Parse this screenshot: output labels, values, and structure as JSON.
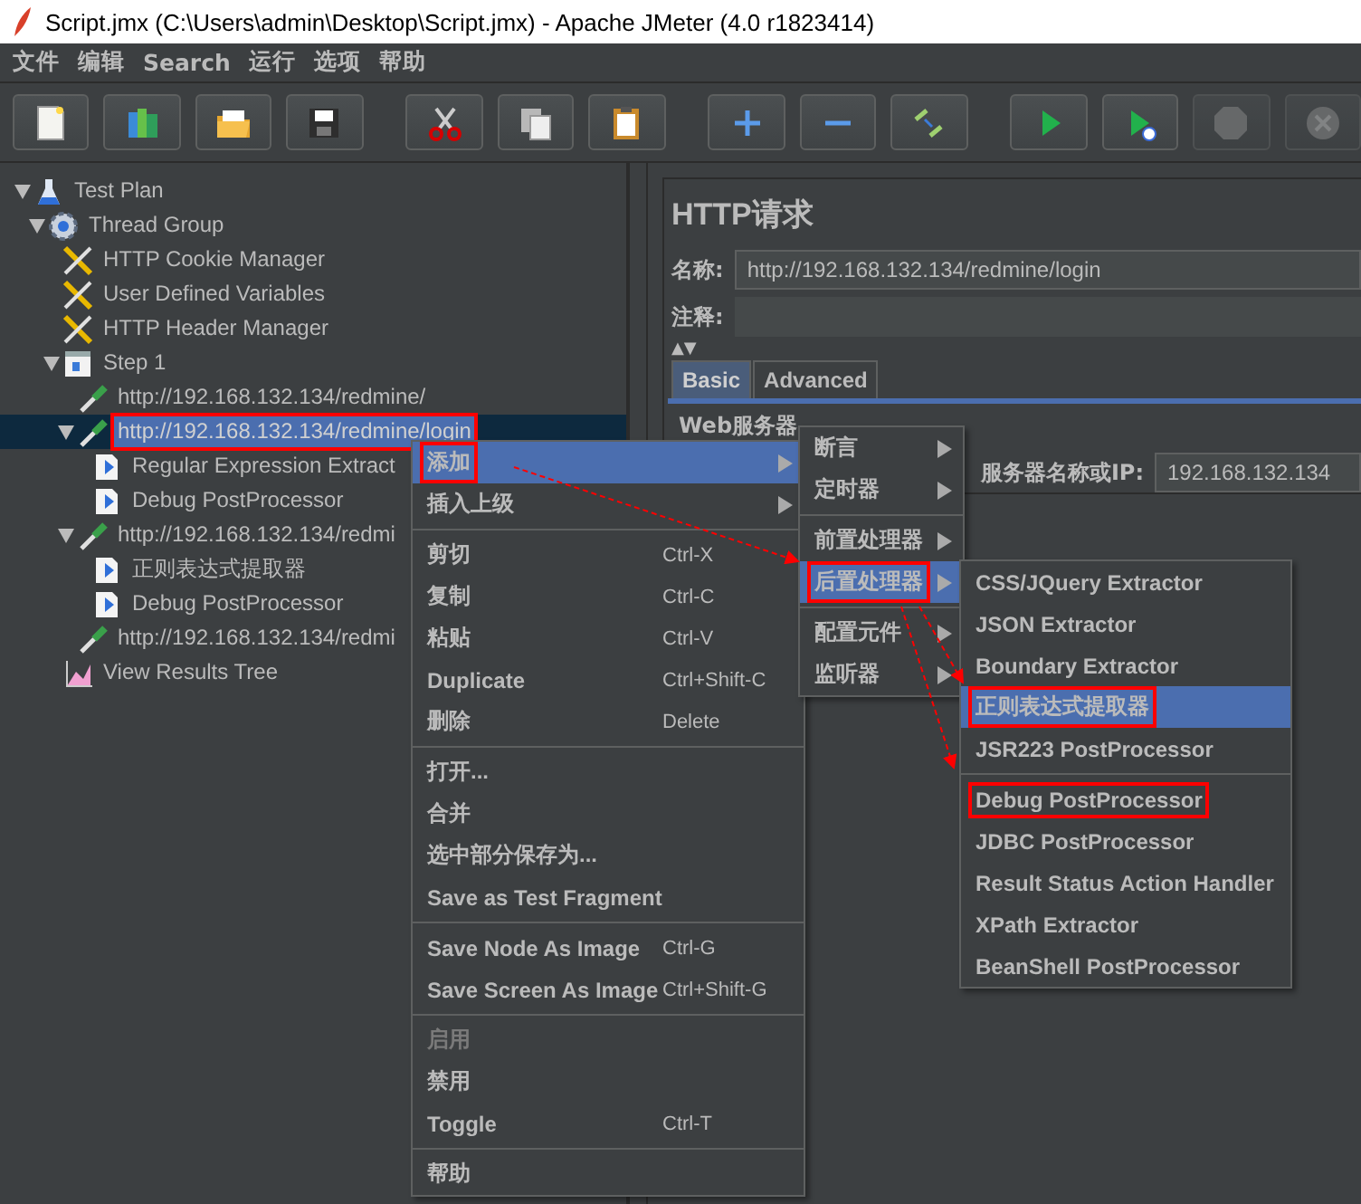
{
  "window": {
    "title": "Script.jmx (C:\\Users\\admin\\Desktop\\Script.jmx) - Apache JMeter (4.0 r1823414)"
  },
  "menubar": [
    "文件",
    "编辑",
    "Search",
    "运行",
    "选项",
    "帮助"
  ],
  "toolbar": [
    {
      "kind": "new",
      "disabled": false
    },
    {
      "kind": "templates",
      "disabled": false
    },
    {
      "kind": "open",
      "disabled": false
    },
    {
      "kind": "save",
      "disabled": false
    },
    {
      "kind": "gap"
    },
    {
      "kind": "cut",
      "disabled": false
    },
    {
      "kind": "copy",
      "disabled": false
    },
    {
      "kind": "paste",
      "disabled": false
    },
    {
      "kind": "gap"
    },
    {
      "kind": "expand",
      "disabled": false
    },
    {
      "kind": "collapse",
      "disabled": false
    },
    {
      "kind": "toggle",
      "disabled": false
    },
    {
      "kind": "gap"
    },
    {
      "kind": "start",
      "disabled": false
    },
    {
      "kind": "start-no-timers",
      "disabled": false
    },
    {
      "kind": "stop",
      "disabled": true
    },
    {
      "kind": "shutdown",
      "disabled": true
    }
  ],
  "tree": [
    {
      "label": "Test Plan",
      "kind": "testplan",
      "expanded": true,
      "selected": false,
      "marked": false,
      "children": [
        {
          "label": "Thread Group",
          "kind": "threadgroup",
          "expanded": true,
          "selected": false,
          "marked": false,
          "children": [
            {
              "label": "HTTP Cookie Manager",
              "kind": "config",
              "selected": false,
              "marked": false
            },
            {
              "label": "User Defined Variables",
              "kind": "config",
              "selected": false,
              "marked": false
            },
            {
              "label": "HTTP Header Manager",
              "kind": "config",
              "selected": false,
              "marked": false
            },
            {
              "label": "Step 1",
              "kind": "controller",
              "expanded": true,
              "selected": false,
              "marked": false,
              "children": [
                {
                  "label": "http://192.168.132.134/redmine/",
                  "kind": "sampler",
                  "selected": false,
                  "marked": false
                },
                {
                  "label": "http://192.168.132.134/redmine/login",
                  "kind": "sampler",
                  "expanded": true,
                  "selected": true,
                  "marked": true,
                  "children": [
                    {
                      "label": "Regular Expression Extract",
                      "kind": "postprocessor",
                      "selected": false,
                      "marked": false
                    },
                    {
                      "label": "Debug PostProcessor",
                      "kind": "postprocessor",
                      "selected": false,
                      "marked": false
                    }
                  ]
                },
                {
                  "label": "http://192.168.132.134/redmi",
                  "kind": "sampler",
                  "expanded": true,
                  "selected": false,
                  "marked": false,
                  "children": [
                    {
                      "label": "正则表达式提取器",
                      "kind": "postprocessor",
                      "selected": false,
                      "marked": false
                    },
                    {
                      "label": "Debug PostProcessor",
                      "kind": "postprocessor",
                      "selected": false,
                      "marked": false
                    }
                  ]
                },
                {
                  "label": "http://192.168.132.134/redmi",
                  "kind": "sampler",
                  "selected": false,
                  "marked": false
                }
              ]
            },
            {
              "label": "View Results Tree",
              "kind": "listener",
              "selected": false,
              "marked": false
            }
          ]
        }
      ]
    }
  ],
  "editor": {
    "title": "HTTP请求",
    "name_label": "名称:",
    "name_value": "http://192.168.132.134/redmine/login",
    "comment_label": "注释:",
    "collapse_arrows": "▲▼",
    "tabs": [
      {
        "label": "Basic",
        "selected": true
      },
      {
        "label": "Advanced",
        "selected": false
      }
    ],
    "group_title": "Web服务器",
    "server_label": "服务器名称或IP:",
    "server_value": "192.168.132.134"
  },
  "context_menu": {
    "items": [
      {
        "kind": "submenu",
        "label": "添加",
        "selected": true,
        "marked": true,
        "disabled": false,
        "submenu": {
          "items": [
            {
              "kind": "submenu",
              "label": "断言",
              "selected": false,
              "marked": false
            },
            {
              "kind": "submenu",
              "label": "定时器",
              "selected": false,
              "marked": false
            },
            {
              "kind": "separator"
            },
            {
              "kind": "submenu",
              "label": "前置处理器",
              "selected": false,
              "marked": false
            },
            {
              "kind": "submenu",
              "label": "后置处理器",
              "selected": true,
              "marked": true,
              "submenu": {
                "items": [
                  {
                    "kind": "item",
                    "label": "CSS/JQuery Extractor",
                    "selected": false,
                    "marked": false
                  },
                  {
                    "kind": "item",
                    "label": "JSON Extractor",
                    "selected": false,
                    "marked": false
                  },
                  {
                    "kind": "item",
                    "label": "Boundary Extractor",
                    "selected": false,
                    "marked": false
                  },
                  {
                    "kind": "item",
                    "label": "正则表达式提取器",
                    "selected": true,
                    "marked": true
                  },
                  {
                    "kind": "item",
                    "label": "JSR223 PostProcessor",
                    "selected": false,
                    "marked": false
                  },
                  {
                    "kind": "separator"
                  },
                  {
                    "kind": "item",
                    "label": "Debug PostProcessor",
                    "selected": false,
                    "marked": true
                  },
                  {
                    "kind": "item",
                    "label": "JDBC PostProcessor",
                    "selected": false,
                    "marked": false
                  },
                  {
                    "kind": "item",
                    "label": "Result Status Action Handler",
                    "selected": false,
                    "marked": false
                  },
                  {
                    "kind": "item",
                    "label": "XPath Extractor",
                    "selected": false,
                    "marked": false
                  },
                  {
                    "kind": "item",
                    "label": "BeanShell PostProcessor",
                    "selected": false,
                    "marked": false
                  }
                ]
              }
            },
            {
              "kind": "separator"
            },
            {
              "kind": "submenu",
              "label": "配置元件",
              "selected": false,
              "marked": false
            },
            {
              "kind": "submenu",
              "label": "监听器",
              "selected": false,
              "marked": false
            }
          ]
        }
      },
      {
        "kind": "submenu",
        "label": "插入上级",
        "selected": false,
        "marked": false,
        "disabled": false
      },
      {
        "kind": "separator"
      },
      {
        "kind": "item",
        "label": "剪切",
        "shortcut": "Ctrl-X",
        "selected": false,
        "marked": false,
        "disabled": false
      },
      {
        "kind": "item",
        "label": "复制",
        "shortcut": "Ctrl-C",
        "selected": false,
        "marked": false,
        "disabled": false
      },
      {
        "kind": "item",
        "label": "粘贴",
        "shortcut": "Ctrl-V",
        "selected": false,
        "marked": false,
        "disabled": false
      },
      {
        "kind": "item",
        "label": "Duplicate",
        "shortcut": "Ctrl+Shift-C",
        "selected": false,
        "marked": false,
        "disabled": false
      },
      {
        "kind": "item",
        "label": "删除",
        "shortcut": "Delete",
        "selected": false,
        "marked": false,
        "disabled": false
      },
      {
        "kind": "separator"
      },
      {
        "kind": "item",
        "label": "打开...",
        "selected": false,
        "marked": false,
        "disabled": false
      },
      {
        "kind": "item",
        "label": "合并",
        "selected": false,
        "marked": false,
        "disabled": false
      },
      {
        "kind": "item",
        "label": "选中部分保存为...",
        "selected": false,
        "marked": false,
        "disabled": false
      },
      {
        "kind": "item",
        "label": "Save as Test Fragment",
        "selected": false,
        "marked": false,
        "disabled": false
      },
      {
        "kind": "separator"
      },
      {
        "kind": "item",
        "label": "Save Node As Image",
        "shortcut": "Ctrl-G",
        "selected": false,
        "marked": false,
        "disabled": false
      },
      {
        "kind": "item",
        "label": "Save Screen As Image",
        "shortcut": "Ctrl+Shift-G",
        "selected": false,
        "marked": false,
        "disabled": false
      },
      {
        "kind": "separator"
      },
      {
        "kind": "item",
        "label": "启用",
        "selected": false,
        "marked": false,
        "disabled": true
      },
      {
        "kind": "item",
        "label": "禁用",
        "selected": false,
        "marked": false,
        "disabled": false
      },
      {
        "kind": "item",
        "label": "Toggle",
        "shortcut": "Ctrl-T",
        "selected": false,
        "marked": false,
        "disabled": false
      },
      {
        "kind": "separator"
      },
      {
        "kind": "item",
        "label": "帮助",
        "selected": false,
        "marked": false,
        "disabled": false
      }
    ]
  }
}
